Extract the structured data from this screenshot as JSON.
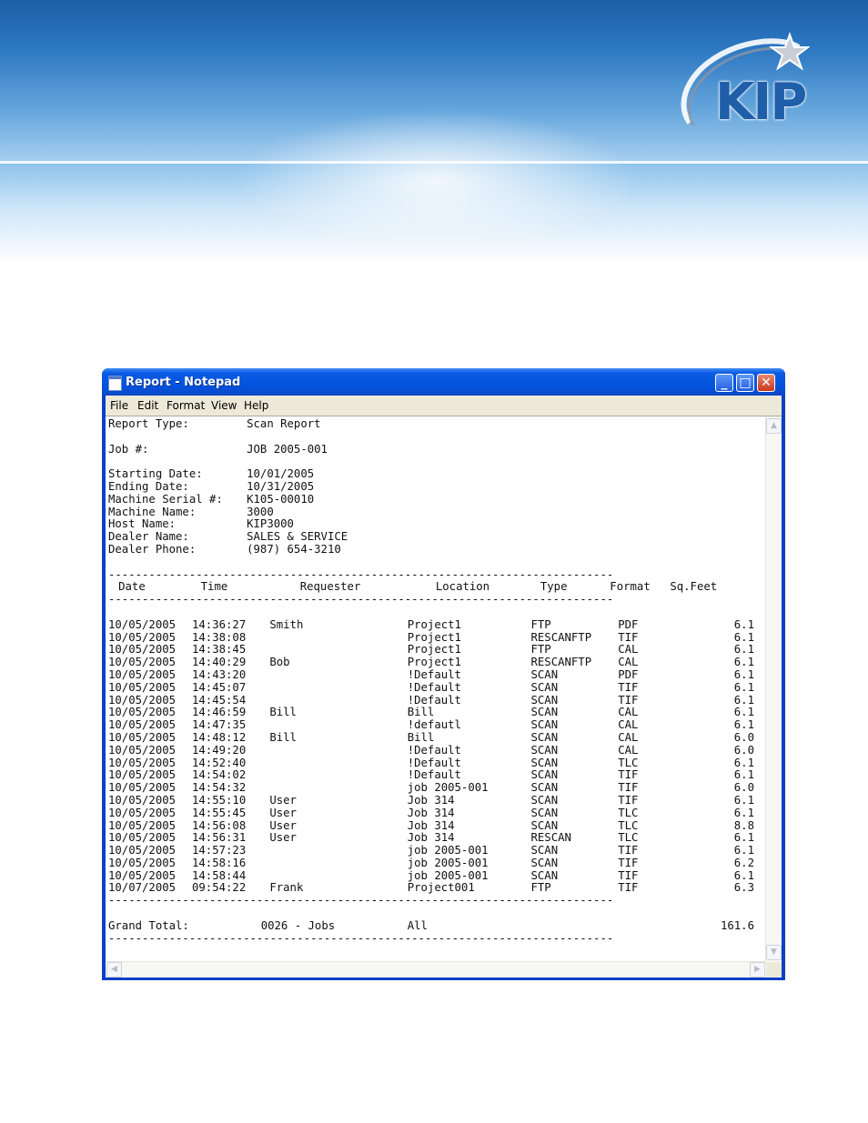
{
  "brand": {
    "logo_text": "KIP"
  },
  "window": {
    "title": "Report - Notepad",
    "buttons": {
      "minimize": "_",
      "maximize": "□",
      "close": "✕"
    }
  },
  "menu": [
    "File",
    "Edit",
    "Format",
    "View",
    "Help"
  ],
  "report": {
    "report_type": {
      "label": "Report Type:",
      "value": "Scan Report"
    },
    "job": {
      "label": "Job #:",
      "value": "JOB 2005-001"
    },
    "meta": [
      {
        "label": "Starting Date:",
        "value": "10/01/2005"
      },
      {
        "label": "Ending Date:",
        "value": "10/31/2005"
      },
      {
        "label": "Machine Serial #:",
        "value": "K105-00010"
      },
      {
        "label": "Machine Name:",
        "value": "3000"
      },
      {
        "label": "Host Name:",
        "value": "KIP3000"
      },
      {
        "label": "Dealer Name:",
        "value": "SALES & SERVICE"
      },
      {
        "label": "Dealer Phone:",
        "value": "(987) 654-3210"
      }
    ],
    "divider": "---------------------------------------------------------------------------",
    "columns": [
      "Date",
      "Time",
      "Requester",
      "Location",
      "Type",
      "Format",
      "Sq.Feet"
    ],
    "rows": [
      {
        "date": "10/05/2005",
        "time": "14:36:27",
        "requester": "Smith",
        "location": "Project1",
        "type": "FTP",
        "format": "PDF",
        "sqft": "6.1"
      },
      {
        "date": "10/05/2005",
        "time": "14:38:08",
        "requester": "",
        "location": "Project1",
        "type": "RESCANFTP",
        "format": "TIF",
        "sqft": "6.1"
      },
      {
        "date": "10/05/2005",
        "time": "14:38:45",
        "requester": "",
        "location": "Project1",
        "type": "FTP",
        "format": "CAL",
        "sqft": "6.1"
      },
      {
        "date": "10/05/2005",
        "time": "14:40:29",
        "requester": "Bob",
        "location": "Project1",
        "type": "RESCANFTP",
        "format": "CAL",
        "sqft": "6.1"
      },
      {
        "date": "10/05/2005",
        "time": "14:43:20",
        "requester": "",
        "location": "!Default",
        "type": "SCAN",
        "format": "PDF",
        "sqft": "6.1"
      },
      {
        "date": "10/05/2005",
        "time": "14:45:07",
        "requester": "",
        "location": "!Default",
        "type": "SCAN",
        "format": "TIF",
        "sqft": "6.1"
      },
      {
        "date": "10/05/2005",
        "time": "14:45:54",
        "requester": "",
        "location": "!Default",
        "type": "SCAN",
        "format": "TIF",
        "sqft": "6.1"
      },
      {
        "date": "10/05/2005",
        "time": "14:46:59",
        "requester": "Bill",
        "location": "Bill",
        "type": "SCAN",
        "format": "CAL",
        "sqft": "6.1"
      },
      {
        "date": "10/05/2005",
        "time": "14:47:35",
        "requester": "",
        "location": "!defautl",
        "type": "SCAN",
        "format": "CAL",
        "sqft": "6.1"
      },
      {
        "date": "10/05/2005",
        "time": "14:48:12",
        "requester": "Bill",
        "location": "Bill",
        "type": "SCAN",
        "format": "CAL",
        "sqft": "6.0"
      },
      {
        "date": "10/05/2005",
        "time": "14:49:20",
        "requester": "",
        "location": "!Default",
        "type": "SCAN",
        "format": "CAL",
        "sqft": "6.0"
      },
      {
        "date": "10/05/2005",
        "time": "14:52:40",
        "requester": "",
        "location": "!Default",
        "type": "SCAN",
        "format": "TLC",
        "sqft": "6.1"
      },
      {
        "date": "10/05/2005",
        "time": "14:54:02",
        "requester": "",
        "location": "!Default",
        "type": "SCAN",
        "format": "TIF",
        "sqft": "6.1"
      },
      {
        "date": "10/05/2005",
        "time": "14:54:32",
        "requester": "",
        "location": "job 2005-001",
        "type": "SCAN",
        "format": "TIF",
        "sqft": "6.0"
      },
      {
        "date": "10/05/2005",
        "time": "14:55:10",
        "requester": "User",
        "location": "Job 314",
        "type": "SCAN",
        "format": "TIF",
        "sqft": "6.1"
      },
      {
        "date": "10/05/2005",
        "time": "14:55:45",
        "requester": "User",
        "location": "Job 314",
        "type": "SCAN",
        "format": "TLC",
        "sqft": "6.1"
      },
      {
        "date": "10/05/2005",
        "time": "14:56:08",
        "requester": "User",
        "location": "Job 314",
        "type": "SCAN",
        "format": "TLC",
        "sqft": "8.8"
      },
      {
        "date": "10/05/2005",
        "time": "14:56:31",
        "requester": "User",
        "location": "Job 314",
        "type": "RESCAN",
        "format": "TLC",
        "sqft": "6.1"
      },
      {
        "date": "10/05/2005",
        "time": "14:57:23",
        "requester": "",
        "location": "job 2005-001",
        "type": "SCAN",
        "format": "TIF",
        "sqft": "6.1"
      },
      {
        "date": "10/05/2005",
        "time": "14:58:16",
        "requester": "",
        "location": "job 2005-001",
        "type": "SCAN",
        "format": "TIF",
        "sqft": "6.2"
      },
      {
        "date": "10/05/2005",
        "time": "14:58:44",
        "requester": "",
        "location": "job 2005-001",
        "type": "SCAN",
        "format": "TIF",
        "sqft": "6.1"
      },
      {
        "date": "10/07/2005",
        "time": "09:54:22",
        "requester": "Frank",
        "location": "Project001",
        "type": "FTP",
        "format": "TIF",
        "sqft": "6.3"
      }
    ],
    "total": {
      "label": "Grand Total:",
      "jobs": "0026 - Jobs",
      "location": "All",
      "sqft": "161.6"
    }
  }
}
